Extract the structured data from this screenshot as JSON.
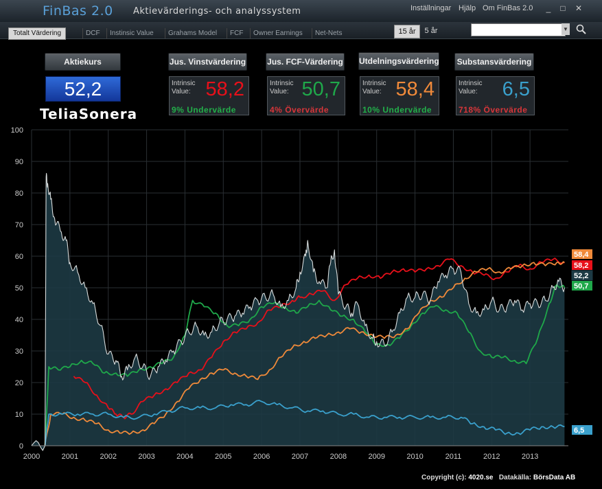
{
  "app": {
    "name": "FinBas 2.0",
    "subtitle": "Aktievärderings- och analyssystem"
  },
  "menu": {
    "settings": "Inställningar",
    "help": "Hjälp",
    "about": "Om FinBas 2.0"
  },
  "window": {
    "minimize": "_",
    "maximize": "□",
    "close": "✕"
  },
  "tabs": [
    "Totalt Värdering",
    "DCF",
    "Instinsic Value",
    "Grahams Model",
    "FCF",
    "Owner Earnings",
    "Net-Nets"
  ],
  "active_tab": "Totalt Värdering",
  "period": {
    "options": [
      "15 år",
      "5 år"
    ],
    "selected": "15 år"
  },
  "search": {
    "value": ""
  },
  "stock": {
    "price_label": "Aktiekurs",
    "price": "52,2",
    "company": "TeliaSonera"
  },
  "valuations": [
    {
      "label": "Jus. Vinstvärdering",
      "intrinsic": "Intrinsic",
      "value_label": "Value:",
      "value": "58,2",
      "verdict_pct": "9%",
      "verdict": "Undervärde",
      "color": "#e8101a",
      "verdict_color": "#22b04a"
    },
    {
      "label": "Jus. FCF-Värdering",
      "intrinsic": "Intrinsic",
      "value_label": "Value:",
      "value": "50,7",
      "verdict_pct": "4%",
      "verdict": "Övervärde",
      "color": "#1fa84a",
      "verdict_color": "#d8363a"
    },
    {
      "label": "Utdelningsvärdering",
      "intrinsic": "Intrinsic",
      "value_label": "Value:",
      "value": "58,4",
      "verdict_pct": "10%",
      "verdict": "Undervärde",
      "color": "#f08a3a",
      "verdict_color": "#22b04a"
    },
    {
      "label": "Substansvärdering",
      "intrinsic": "Intrinsic",
      "value_label": "Value:",
      "value": "6,5",
      "verdict_pct": "718%",
      "verdict": "Övervärde",
      "color": "#3aa0cc",
      "verdict_color": "#d8363a"
    }
  ],
  "chart_data": {
    "type": "line",
    "x_ticks": [
      "2000",
      "2001",
      "2002",
      "2003",
      "2004",
      "2005",
      "2006",
      "2007",
      "2008",
      "2009",
      "2010",
      "2011",
      "2012",
      "2013"
    ],
    "y_ticks": [
      "0",
      "10",
      "20",
      "30",
      "40",
      "50",
      "60",
      "70",
      "80",
      "90",
      "100"
    ],
    "ylim": [
      0,
      100
    ],
    "xlim": [
      2000,
      2014
    ],
    "series": [
      {
        "name": "Aktiekurs",
        "color": "#d8dcdc",
        "fill": "#1d3a44",
        "x": [
          2000.0,
          2000.35,
          2000.38,
          2000.42,
          2000.5,
          2000.6,
          2000.75,
          2000.9,
          2001.0,
          2001.2,
          2001.4,
          2001.6,
          2001.8,
          2002.0,
          2002.2,
          2002.35,
          2002.5,
          2002.7,
          2002.9,
          2003.1,
          2003.3,
          2003.5,
          2003.7,
          2003.9,
          2004.1,
          2004.3,
          2004.5,
          2004.7,
          2004.9,
          2005.1,
          2005.3,
          2005.5,
          2005.7,
          2005.9,
          2006.1,
          2006.3,
          2006.5,
          2006.7,
          2006.9,
          2007.0,
          2007.15,
          2007.2,
          2007.35,
          2007.5,
          2007.7,
          2007.8,
          2007.9,
          2008.0,
          2008.2,
          2008.35,
          2008.5,
          2008.7,
          2008.9,
          2009.0,
          2009.2,
          2009.4,
          2009.6,
          2009.8,
          2010.0,
          2010.2,
          2010.4,
          2010.6,
          2010.8,
          2011.0,
          2011.2,
          2011.4,
          2011.6,
          2011.8,
          2012.0,
          2012.2,
          2012.4,
          2012.6,
          2012.8,
          2013.0,
          2013.2,
          2013.4,
          2013.6,
          2013.75,
          2013.9
        ],
        "values": [
          0,
          0,
          85,
          83,
          78,
          72,
          68,
          65,
          58,
          55,
          50,
          45,
          38,
          29,
          27,
          22,
          24,
          28,
          25,
          22,
          25,
          27,
          30,
          33,
          36,
          38,
          35,
          36,
          39,
          40,
          41,
          42,
          44,
          46,
          47,
          48,
          44,
          46,
          50,
          55,
          60,
          65,
          55,
          52,
          50,
          58,
          62,
          48,
          44,
          42,
          45,
          38,
          34,
          33,
          32,
          36,
          42,
          47,
          47,
          48,
          46,
          52,
          54,
          56,
          55,
          45,
          42,
          43,
          46,
          43,
          44,
          46,
          43,
          45,
          45,
          46,
          50,
          52,
          50
        ]
      },
      {
        "name": "Jus. Vinstvärdering",
        "color": "#e8101a",
        "x": [
          2001.1,
          2001.4,
          2001.7,
          2002.0,
          2002.2,
          2002.4,
          2002.6,
          2002.9,
          2003.2,
          2003.5,
          2003.8,
          2004.1,
          2004.4,
          2004.7,
          2005.0,
          2005.3,
          2005.6,
          2005.9,
          2006.2,
          2006.5,
          2006.8,
          2007.0,
          2007.3,
          2007.6,
          2007.9,
          2008.2,
          2008.5,
          2008.8,
          2009.1,
          2009.4,
          2009.7,
          2010.0,
          2010.3,
          2010.6,
          2010.9,
          2011.2,
          2011.5,
          2011.8,
          2012.1,
          2012.4,
          2012.7,
          2013.0,
          2013.3,
          2013.6,
          2013.9
        ],
        "values": [
          22,
          20,
          16,
          12,
          10,
          9,
          10,
          14,
          16,
          18,
          20,
          23,
          24,
          28,
          33,
          36,
          37,
          39,
          43,
          44,
          46,
          47,
          48,
          49,
          46,
          51,
          53,
          54,
          53,
          55,
          56,
          55,
          56,
          57,
          59,
          57,
          55,
          54,
          53,
          55,
          57,
          56,
          58,
          59,
          58
        ]
      },
      {
        "name": "Jus. FCF-Värdering",
        "color": "#1fa84a",
        "x": [
          2000.35,
          2000.45,
          2000.7,
          2001.0,
          2001.3,
          2001.6,
          2001.9,
          2002.2,
          2002.5,
          2002.8,
          2003.1,
          2003.4,
          2003.7,
          2004.0,
          2004.2,
          2004.5,
          2004.8,
          2005.1,
          2005.4,
          2005.7,
          2006.0,
          2006.3,
          2006.6,
          2006.9,
          2007.2,
          2007.5,
          2007.8,
          2008.1,
          2008.4,
          2008.7,
          2009.0,
          2009.3,
          2009.6,
          2009.9,
          2010.2,
          2010.5,
          2010.8,
          2011.1,
          2011.4,
          2011.7,
          2012.0,
          2012.3,
          2012.6,
          2012.9,
          2013.2,
          2013.5,
          2013.7,
          2013.9
        ],
        "values": [
          0,
          25,
          24,
          25,
          27,
          26,
          23,
          23,
          22,
          24,
          25,
          26,
          28,
          35,
          46,
          44,
          42,
          38,
          38,
          40,
          44,
          45,
          44,
          42,
          44,
          46,
          43,
          41,
          40,
          36,
          32,
          32,
          34,
          38,
          42,
          44,
          43,
          42,
          36,
          30,
          28,
          28,
          27,
          26,
          34,
          45,
          51,
          50
        ]
      },
      {
        "name": "Utdelningsvärdering",
        "color": "#f08a3a",
        "x": [
          2000.35,
          2000.5,
          2000.8,
          2001.1,
          2001.4,
          2001.7,
          2002.0,
          2002.3,
          2002.6,
          2002.9,
          2003.2,
          2003.5,
          2003.8,
          2004.1,
          2004.4,
          2004.7,
          2005.0,
          2005.3,
          2005.6,
          2005.9,
          2006.2,
          2006.5,
          2006.8,
          2007.1,
          2007.4,
          2007.7,
          2008.0,
          2008.3,
          2008.6,
          2008.9,
          2009.2,
          2009.5,
          2009.8,
          2010.1,
          2010.4,
          2010.7,
          2011.0,
          2011.3,
          2011.6,
          2011.9,
          2012.2,
          2012.5,
          2012.8,
          2013.1,
          2013.4,
          2013.7,
          2013.9
        ],
        "values": [
          0,
          10,
          10,
          9,
          8,
          7,
          5,
          4,
          4,
          5,
          7,
          10,
          14,
          18,
          21,
          23,
          24,
          23,
          22,
          21,
          24,
          28,
          31,
          33,
          34,
          35,
          36,
          37,
          36,
          35,
          34,
          35,
          37,
          42,
          46,
          47,
          50,
          53,
          55,
          56,
          55,
          56,
          57,
          58,
          57,
          58,
          58
        ]
      },
      {
        "name": "Substansvärdering",
        "color": "#3aa0cc",
        "x": [
          2000.35,
          2000.45,
          2000.8,
          2001.2,
          2001.6,
          2002.0,
          2002.4,
          2002.8,
          2003.2,
          2003.6,
          2004.0,
          2004.4,
          2004.8,
          2005.2,
          2005.6,
          2006.0,
          2006.4,
          2006.8,
          2007.2,
          2007.6,
          2008.0,
          2008.4,
          2008.8,
          2009.2,
          2009.6,
          2010.0,
          2010.4,
          2010.8,
          2011.2,
          2011.5,
          2011.8,
          2012.1,
          2012.4,
          2012.7,
          2013.0,
          2013.3,
          2013.6,
          2013.9
        ],
        "values": [
          0,
          10,
          10,
          10,
          10,
          10,
          9,
          9,
          10,
          11,
          12,
          12,
          12,
          13,
          13,
          14,
          13,
          12,
          11,
          11,
          10,
          10,
          9,
          9,
          9,
          9,
          9,
          9,
          9,
          7,
          6,
          5,
          4,
          4,
          5,
          6,
          6,
          6
        ]
      }
    ],
    "end_labels": [
      {
        "text": "58,4",
        "value": 58.4,
        "bg": "#f08a3a"
      },
      {
        "text": "58,2",
        "value": 58.2,
        "bg": "#e8101a"
      },
      {
        "text": "52,2",
        "value": 52.2,
        "bg": "#1d3a44"
      },
      {
        "text": "50,7",
        "value": 50.7,
        "bg": "#1fa84a"
      },
      {
        "text": "6,5",
        "value": 6.5,
        "bg": "#3aa0cc"
      }
    ]
  },
  "footer": {
    "copyright_prefix": "Copyright (c):",
    "site": "4020.se",
    "source_prefix": "Datakälla:",
    "source": "BörsData AB"
  }
}
